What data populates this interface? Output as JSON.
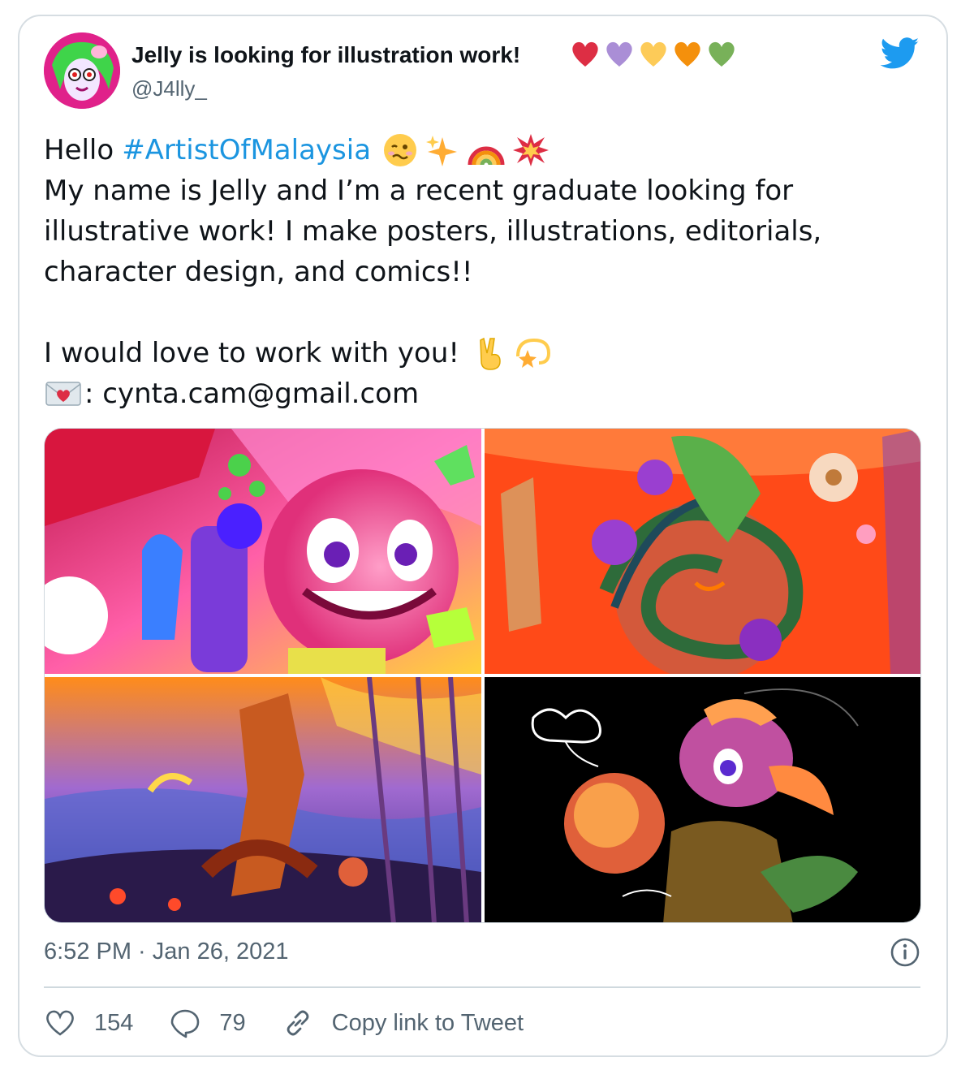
{
  "tweet": {
    "display_name": "Jelly is looking for illustration work!",
    "name_hearts": [
      "#dd2e44",
      "#aa8ed6",
      "#fdcb58",
      "#f4900c",
      "#78b159"
    ],
    "handle": "@J4lly_",
    "brand_color": "#1d9bf0",
    "icons": {
      "avatar": "avatar",
      "logo": "twitter-bird-icon"
    },
    "text": {
      "line1_prefix": "Hello",
      "hashtag": "#ArtistOfMalaysia",
      "line1_emojis": [
        "woozy-face-emoji",
        "sparkles-emoji",
        "rainbow-emoji",
        "collision-emoji"
      ],
      "line2": "My name is Jelly and I’m a recent graduate looking for",
      "line3": "illustrative work! I make posters, illustrations, editorials,",
      "line4": "character design, and comics!!",
      "line6": "I would love to work with you!",
      "line6_emojis": [
        "victory-hand-emoji",
        "dizzy-emoji"
      ],
      "contact_emoji": "love-letter-emoji",
      "contact": ": cynta.cam@gmail.com"
    },
    "media": [
      "illustration-1",
      "illustration-2",
      "illustration-3",
      "illustration-4"
    ],
    "timestamp": "6:52 PM · Jan 26, 2021",
    "actions": {
      "likes": "154",
      "replies": "79",
      "copy_link": "Copy link to Tweet"
    }
  }
}
